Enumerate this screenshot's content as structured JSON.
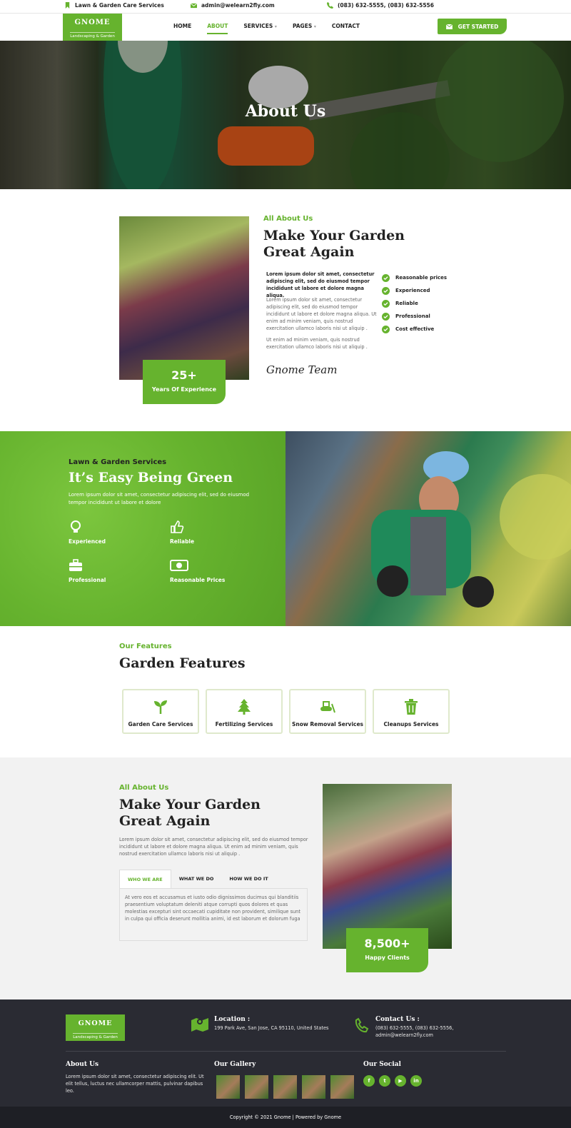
{
  "topbar": {
    "service": "Lawn & Garden Care Services",
    "email": "admin@welearn2fly.com",
    "phone": "(083) 632-5555, (083) 632-5556"
  },
  "brand": {
    "name": "GNOME",
    "tagline": "Landscaping & Garden",
    "accent": "#66b32e"
  },
  "nav": {
    "items": [
      {
        "label": "HOME"
      },
      {
        "label": "ABOUT"
      },
      {
        "label": "SERVICES",
        "caret": "▾"
      },
      {
        "label": "PAGES",
        "caret": "▾"
      },
      {
        "label": "CONTACT"
      }
    ],
    "active": "ABOUT",
    "cta": "GET STARTED"
  },
  "hero": {
    "title": "About Us"
  },
  "about": {
    "kicker": "All About Us",
    "title": "Make Your Garden Great Again",
    "lead": "Lorem ipsum dolor sit amet, consectetur adipiscing elit, sed do eiusmod tempor incididunt ut labore et dolore magna aliqua.",
    "p1": "Lorem ipsum dolor sit amet, consectetur adipiscing elit, sed do eiusmod tempor incididunt ut labore et dolore magna aliqua. Ut enim ad minim veniam, quis nostrud exercitation ullamco laboris nisi ut aliquip .",
    "p2": "Ut enim ad minim veniam, quis nostrud exercitation ullamco laboris nisi ut aliquip .",
    "checks": [
      "Reasonable prices",
      "Experienced",
      "Reliable",
      "Professional",
      "Cost effective"
    ],
    "signature": "Gnome Team",
    "experience_number": "25+",
    "experience_label": "Years Of Experience"
  },
  "green": {
    "subtitle": "Lawn & Garden Services",
    "title": "It’s Easy Being Green",
    "text": "Lorem ipsum dolor sit amet, consectetur adipiscing elit, sed do eiusmod tempor incididunt ut labore et dolore",
    "features": [
      "Experienced",
      "Reliable",
      "Professional",
      "Reasonable Prices"
    ]
  },
  "features": {
    "kicker": "Our Features",
    "title": "Garden Features",
    "cards": [
      "Garden Care Services",
      "Fertilizing Services",
      "Snow Removal Services",
      "Cleanups Services"
    ]
  },
  "about2": {
    "kicker": "All About Us",
    "title": "Make Your Garden Great Again",
    "text": "Lorem ipsum dolor sit amet, consectetur adipiscing elit, sed do eiusmod tempor incididunt ut labore et dolore magna aliqua. Ut enim ad minim veniam, quis nostrud exercitation ullamco laboris nisi ut aliquip .",
    "tabs": [
      "WHO WE ARE",
      "WHAT WE DO",
      "HOW WE DO IT"
    ],
    "tab_content": "At vero eos et accusamus et iusto odio dignissimos ducimus qui blanditiis praesentium voluptatum deleniti atque corrupti quos dolores et quas molestias excepturi sint occaecati cupiditate non provident, similique sunt in culpa qui officia deserunt mollitia animi, id est laborum et dolorum fuga",
    "clients_number": "8,500+",
    "clients_label": "Happy Clients"
  },
  "footer": {
    "location_title": "Location :",
    "location_text": "199 Park Ave, San Jose, CA 95110, United States",
    "contact_title": "Contact Us :",
    "contact_phone": "(083) 632-5555, (083) 632-5556,",
    "contact_email": "admin@welearn2fly.com",
    "about_title": "About Us",
    "about_text": "Lorem ipsum dolor sit amet, consectetur adipiscing elit. Ut elit tellus, luctus nec ullamcorper mattis, pulvinar dapibus leo.",
    "gallery_title": "Our Gallery",
    "social_title": "Our Social",
    "socials": [
      "f",
      "t",
      "▶",
      "in"
    ],
    "copyright": "Copyright © 2021 Gnome | Powered by Gnome"
  }
}
